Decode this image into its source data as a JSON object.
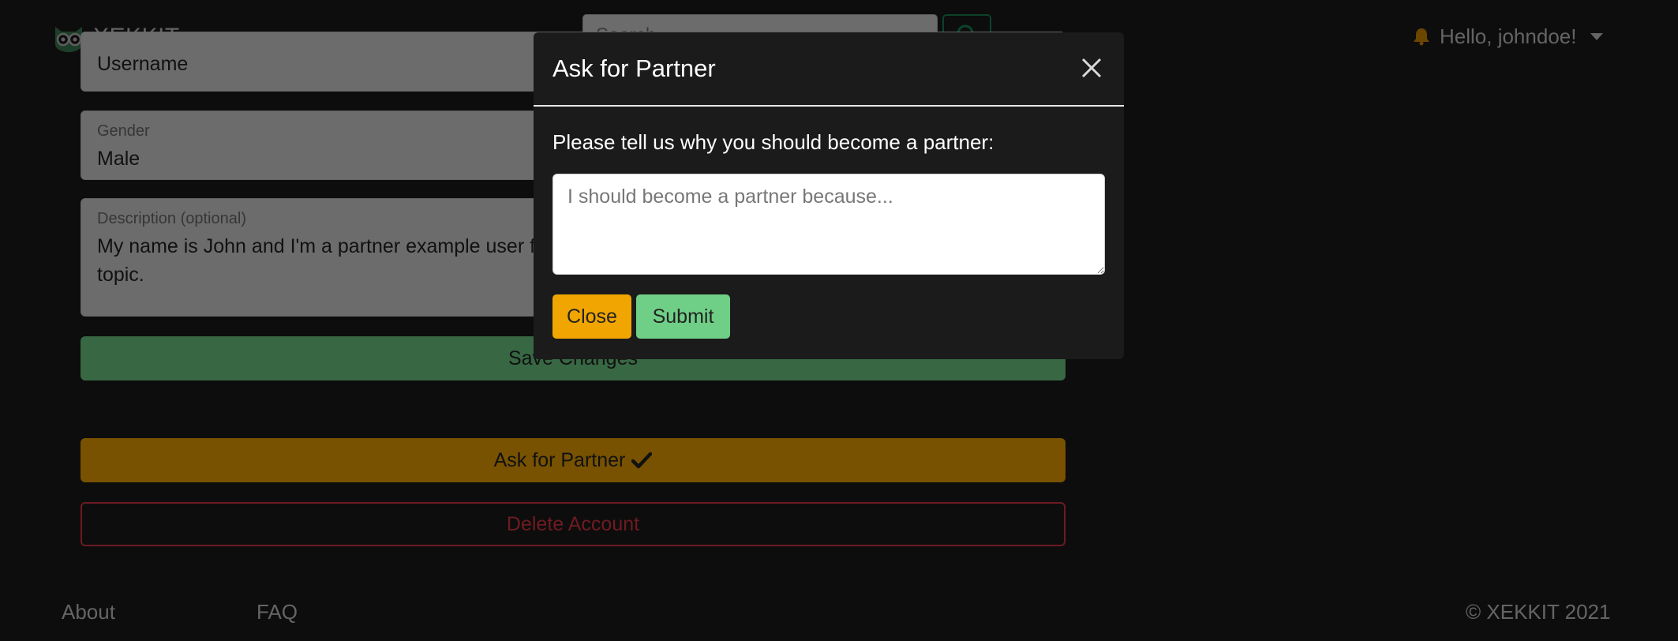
{
  "navbar": {
    "brand": "XEKKIT",
    "search": {
      "placeholder": "Search"
    },
    "user_menu": {
      "label": "Hello, johndoe!",
      "icon": "bell-icon"
    }
  },
  "form": {
    "top_field": {
      "value": "Username"
    },
    "gender": {
      "label": "Gender",
      "value": "Male"
    },
    "description": {
      "label": "Description (optional)",
      "line1": "My name is John and I'm a partner example user f",
      "line2": "topic."
    },
    "save_label": "Save Changes",
    "ask_partner_label": "Ask for Partner",
    "delete_label": "Delete Account"
  },
  "footer": {
    "about": "About",
    "faq": "FAQ",
    "copyright": "© XEKKIT 2021"
  },
  "modal": {
    "title": "Ask for Partner",
    "prompt": "Please tell us why you should become a partner:",
    "textarea_placeholder": "I should become a partner because...",
    "close_label": "Close",
    "submit_label": "Submit"
  },
  "colors": {
    "background": "#1b1b1b",
    "success": "#6fcf86",
    "warning": "#f0a500",
    "danger": "#dc3545",
    "brand_green": "#198754"
  }
}
